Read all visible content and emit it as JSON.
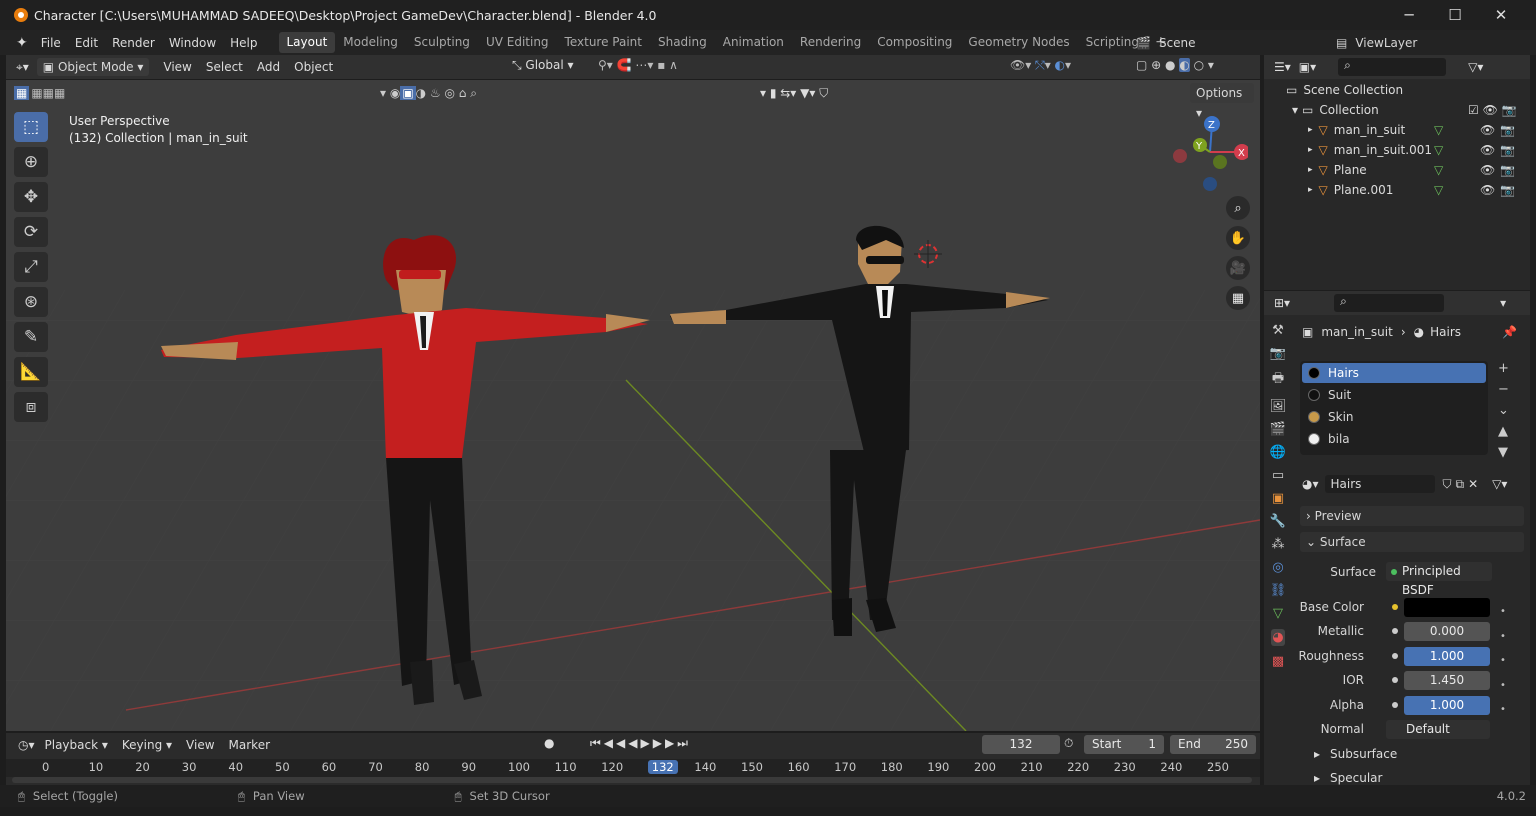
{
  "titlebar": {
    "title": "Character [C:\\Users\\MUHAMMAD SADEEQ\\Desktop\\Project GameDev\\Character.blend] - Blender 4.0",
    "min": "─",
    "max": "☐",
    "close": "✕"
  },
  "menu": {
    "items": [
      "File",
      "Edit",
      "Render",
      "Window",
      "Help"
    ]
  },
  "workspaces": [
    "Layout",
    "Modeling",
    "Sculpting",
    "UV Editing",
    "Texture Paint",
    "Shading",
    "Animation",
    "Rendering",
    "Compositing",
    "Geometry Nodes",
    "Scripting",
    "+"
  ],
  "scene": {
    "scene_label": "Scene",
    "viewlayer_label": "ViewLayer"
  },
  "viewport_header": {
    "mode": "Object Mode",
    "menus": [
      "View",
      "Select",
      "Add",
      "Object"
    ],
    "orientation": "Global",
    "options": "Options"
  },
  "viewport": {
    "perspective": "User Perspective",
    "collection_info": "(132) Collection | man_in_suit"
  },
  "gizmo": {
    "x": "X",
    "y": "Y",
    "z": "Z"
  },
  "outliner": {
    "root": "Scene Collection",
    "collection": "Collection",
    "objects": [
      {
        "name": "man_in_suit"
      },
      {
        "name": "man_in_suit.001"
      },
      {
        "name": "Plane"
      },
      {
        "name": "Plane.001"
      }
    ]
  },
  "properties": {
    "breadcrumb_object": "man_in_suit",
    "breadcrumb_material": "Hairs",
    "material_slots": [
      {
        "name": "Hairs",
        "color": "#000000"
      },
      {
        "name": "Suit",
        "color": "#111111"
      },
      {
        "name": "Skin",
        "color": "#c89a4a"
      },
      {
        "name": "bila",
        "color": "#f0f0f0"
      }
    ],
    "material_name": "Hairs",
    "sections": {
      "preview": "Preview",
      "surface": "Surface",
      "subsurface": "Subsurface",
      "specular": "Specular"
    },
    "fields": {
      "surface_label": "Surface",
      "surface_value": "Principled BSDF",
      "base_color_label": "Base Color",
      "metallic_label": "Metallic",
      "metallic_value": "0.000",
      "roughness_label": "Roughness",
      "roughness_value": "1.000",
      "ior_label": "IOR",
      "ior_value": "1.450",
      "alpha_label": "Alpha",
      "alpha_value": "1.000",
      "normal_label": "Normal",
      "normal_value": "Default"
    }
  },
  "timeline": {
    "menus": [
      "Playback",
      "Keying",
      "View",
      "Marker"
    ],
    "current_frame": "132",
    "start_label": "Start",
    "start_value": "1",
    "end_label": "End",
    "end_value": "250",
    "ruler": [
      "0",
      "10",
      "20",
      "30",
      "40",
      "50",
      "60",
      "70",
      "80",
      "90",
      "100",
      "110",
      "120",
      "132",
      "140",
      "150",
      "160",
      "170",
      "180",
      "190",
      "200",
      "210",
      "220",
      "230",
      "240",
      "250"
    ]
  },
  "statusbar": {
    "select": "Select (Toggle)",
    "pan": "Pan View",
    "cursor": "Set 3D Cursor",
    "version": "4.0.2"
  }
}
